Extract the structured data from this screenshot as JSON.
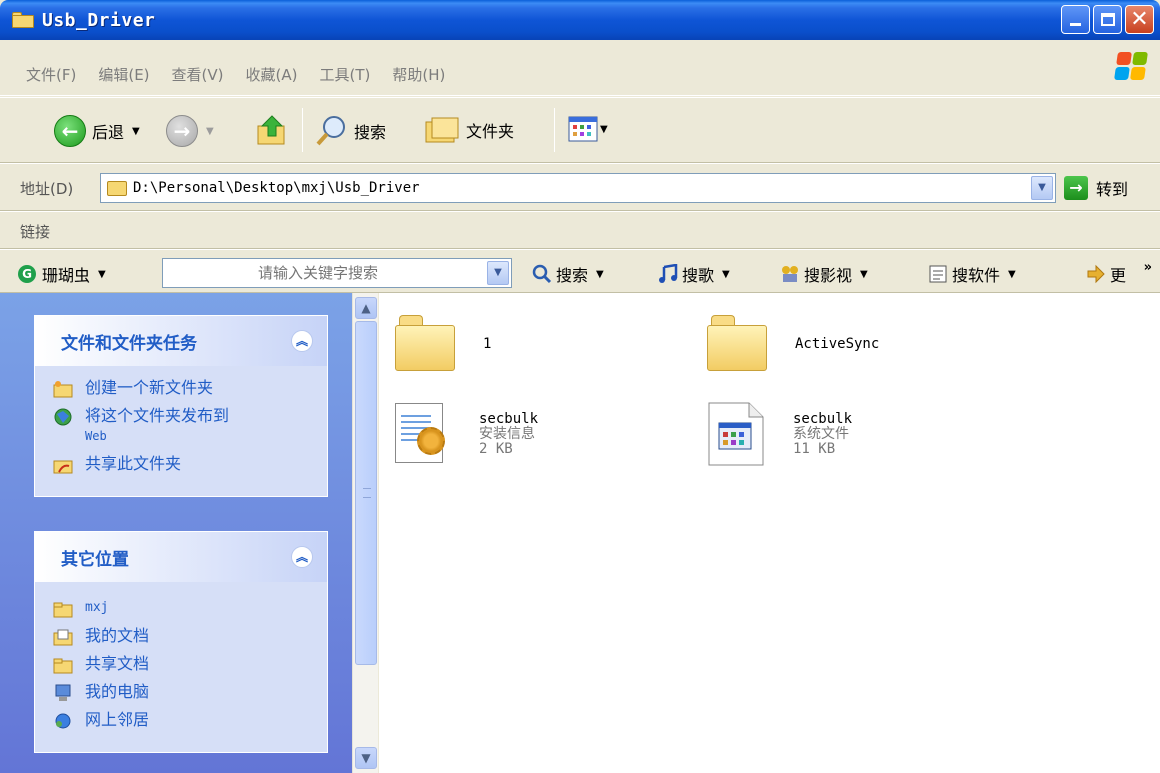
{
  "window": {
    "title": "Usb_Driver"
  },
  "menu": [
    "文件(F)",
    "编辑(E)",
    "查看(V)",
    "收藏(A)",
    "工具(T)",
    "帮助(H)"
  ],
  "toolbar": {
    "back_label": "后退",
    "search_label": "搜索",
    "folders_label": "文件夹"
  },
  "address": {
    "label": "地址(D)",
    "value": "D:\\Personal\\Desktop\\mxj\\Usb_Driver",
    "go_label": "转到"
  },
  "links": {
    "label": "链接"
  },
  "coral": {
    "name": "珊瑚虫",
    "search_placeholder": "请输入关键字搜索",
    "search_label": "搜索",
    "song_label": "搜歌",
    "video_label": "搜影视",
    "software_label": "搜软件",
    "more_label": "更",
    "chevron": "»"
  },
  "panels": {
    "tasks": {
      "title": "文件和文件夹任务",
      "items": [
        {
          "label": "创建一个新文件夹"
        },
        {
          "label": "将这个文件夹发布到",
          "sub": "Web"
        },
        {
          "label": "共享此文件夹"
        }
      ]
    },
    "places": {
      "title": "其它位置",
      "items": [
        {
          "label": "mxj"
        },
        {
          "label": "我的文档"
        },
        {
          "label": "共享文档"
        },
        {
          "label": "我的电脑"
        },
        {
          "label": "网上邻居"
        }
      ]
    }
  },
  "files": [
    {
      "name": "1",
      "type": "",
      "size": ""
    },
    {
      "name": "ActiveSync",
      "type": "",
      "size": ""
    },
    {
      "name": "secbulk",
      "type": "安装信息",
      "size": "2 KB"
    },
    {
      "name": "secbulk",
      "type": "系统文件",
      "size": "11 KB"
    }
  ],
  "colors": {
    "accent": "#215DC6",
    "title_bar": "#0A4FCB",
    "panel_bg": "#6F8CDF"
  }
}
